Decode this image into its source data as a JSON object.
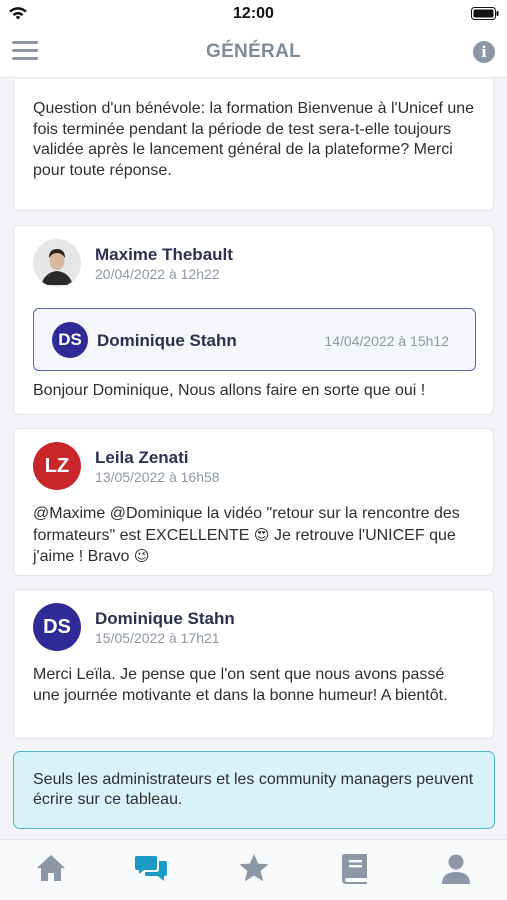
{
  "status_bar": {
    "time": "12:00"
  },
  "nav": {
    "title": "GÉNÉRAL"
  },
  "first_post": {
    "text": "Question d'un bénévole: la formation Bienvenue à l'Unicef une fois terminée pendant la période de test sera-t-elle toujours validée après le lancement général de la plateforme? Merci pour toute réponse."
  },
  "posts": [
    {
      "author": "Maxime Thebault",
      "date": "20/04/2022 à 12h22",
      "quote": {
        "initials": "DS",
        "author": "Dominique Stahn",
        "date": "14/04/2022 à 15h12"
      },
      "text": "Bonjour Dominique, Nous allons faire en sorte que oui !"
    },
    {
      "initials": "LZ",
      "author": "Leila Zenati",
      "date": "13/05/2022 à 16h58",
      "text_line1": "@Maxime @Dominique la vidéo \"retour sur la rencontre des formateurs\" est EXCELLENTE",
      "emoji1": "😍",
      "text_line2": "Je retrouve l'UNICEF que j'aime ! Bravo",
      "emoji2": "😉"
    },
    {
      "initials": "DS",
      "author": "Dominique Stahn",
      "date": "15/05/2022 à 17h21",
      "text": "Merci Leïla. Je pense que l'on sent que nous avons passé une journée motivante et dans la bonne humeur! A bientôt."
    }
  ],
  "notice": {
    "text": "Seuls les administrateurs et les community managers peuvent écrire sur ce tableau."
  },
  "colors": {
    "accent": "#2e2a96",
    "lz_avatar": "#c8262a",
    "active_tab": "#1b9ac4",
    "inactive_tab": "#8b97a6"
  },
  "tabs": [
    {
      "icon": "home-icon",
      "active": false
    },
    {
      "icon": "chat-icon",
      "active": true
    },
    {
      "icon": "star-icon",
      "active": false
    },
    {
      "icon": "book-icon",
      "active": false
    },
    {
      "icon": "profile-icon",
      "active": false
    }
  ]
}
